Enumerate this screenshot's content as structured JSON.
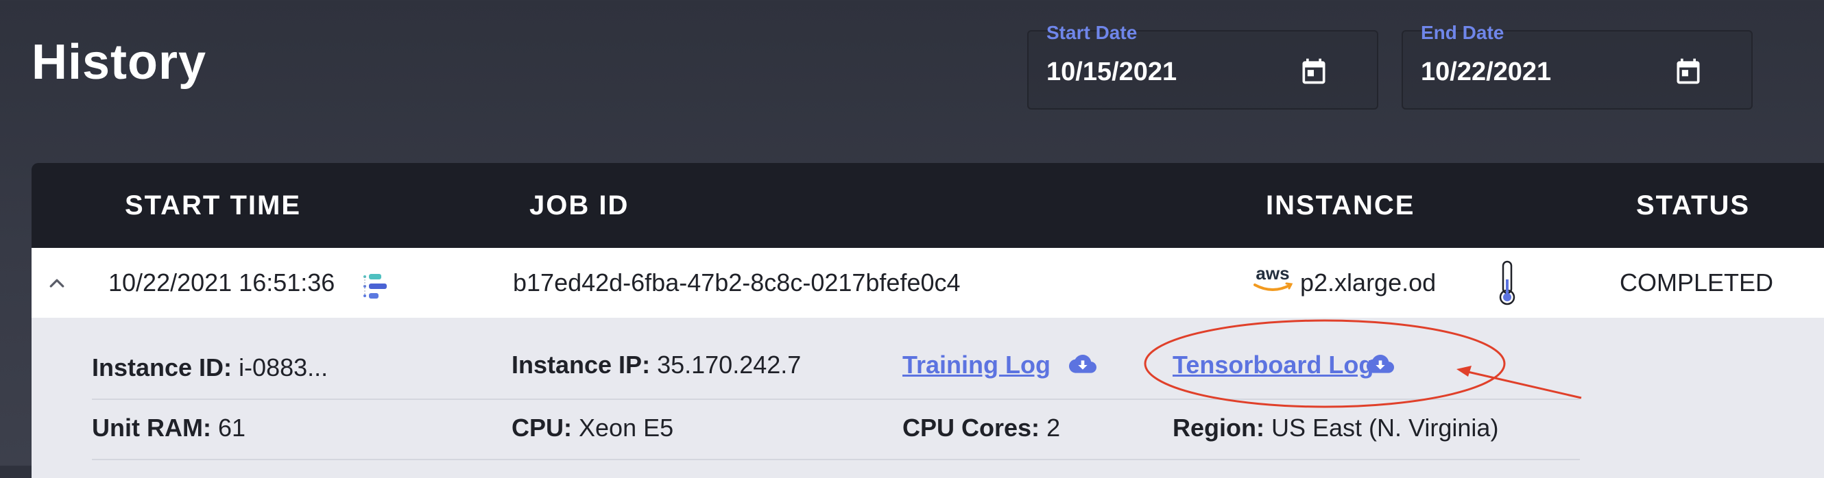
{
  "header": {
    "title": "History"
  },
  "filters": {
    "start_date": {
      "label": "Start Date",
      "value": "10/15/2021",
      "icon": "calendar-icon"
    },
    "end_date": {
      "label": "End Date",
      "value": "10/22/2021",
      "icon": "calendar-icon"
    }
  },
  "table": {
    "columns": [
      "START TIME",
      "JOB ID",
      "INSTANCE",
      "STATUS"
    ],
    "rows": [
      {
        "start_time": "10/22/2021 16:51:36",
        "job_id": "b17ed42d-6fba-47b2-8c8c-0217bfefe0c4",
        "provider_logo": "aws",
        "instance": "p2.xlarge.od",
        "status": "COMPLETED",
        "details": {
          "instance_id_label": "Instance ID:",
          "instance_id": "i-0883...",
          "instance_ip_label": "Instance IP:",
          "instance_ip": "35.170.242.7",
          "training_log": "Training Log",
          "tensorboard_log": "Tensorboard Log",
          "unit_ram_label": "Unit RAM:",
          "unit_ram": "61",
          "cpu_label": "CPU:",
          "cpu": "Xeon E5",
          "cpu_cores_label": "CPU Cores:",
          "cpu_cores": "2",
          "region_label": "Region:",
          "region": "US East (N. Virginia)"
        }
      }
    ]
  },
  "colors": {
    "accent": "#5c73e0",
    "header_bg": "#1c1e26",
    "annotation": "#e0402a"
  }
}
